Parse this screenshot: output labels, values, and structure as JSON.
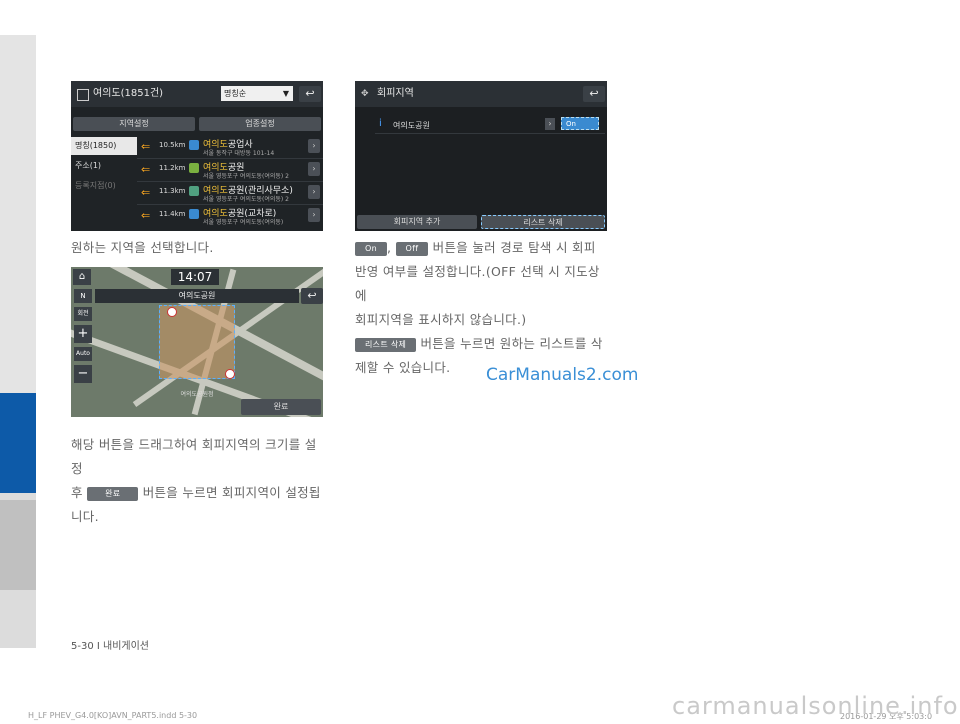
{
  "shot1": {
    "title": "여의도(1851건)",
    "sort_label": "명칭순",
    "tab_region": "지역설정",
    "tab_category": "업종설정",
    "side_tabs": [
      "명칭(1850)",
      "주소(1)",
      "등록지점(0)"
    ],
    "rows": [
      {
        "dist": "10.5km",
        "highlight": "여의도",
        "rest": "공업사",
        "addr": "서울 동작구 대방동 101-14"
      },
      {
        "dist": "11.2km",
        "highlight": "여의도",
        "rest": "공원",
        "addr": "서울 영등포구 여의도동(여의동) 2"
      },
      {
        "dist": "11.3km",
        "highlight": "여의도",
        "rest": "공원(관리사무소)",
        "addr": "서울 영등포구 여의도동(여의동) 2"
      },
      {
        "dist": "11.4km",
        "highlight": "여의도",
        "rest": "공원(교차로)",
        "addr": "서울 영등포구 여의도동(여의동)"
      }
    ]
  },
  "caption1": "원하는 지역을 선택합니다.",
  "shot2": {
    "time": "14:07",
    "place": "여의도공원",
    "done_label": "완료",
    "bottom_label": "여의도공원점",
    "left_controls": [
      "N",
      "회전",
      "+",
      "Auto",
      "−"
    ]
  },
  "caption2": {
    "line1": "해당 버튼을 드래그하여 회피지역의 크기를 설정",
    "line2_pre": "후",
    "pill": "완료",
    "line2_post": "버튼을 누르면 회피지역이 설정됩",
    "line3": "니다."
  },
  "shot3": {
    "title": "회피지역",
    "item": "여의도공원",
    "toggle": "On",
    "btn_add": "회피지역 추가",
    "btn_delete": "리스트 삭제"
  },
  "caption3": {
    "pill_on": "On",
    "comma": ",",
    "pill_off": "Off",
    "line1_post": "버튼을 눌러 경로 탐색 시 회피",
    "line2": "반영 여부를 설정합니다.(OFF 선택 시 지도상에",
    "line3": "회피지역을 표시하지 않습니다.)",
    "pill_delete": "리스트 삭제",
    "line4_post": "버튼을 누르면 원하는 리스트를 삭",
    "line5": "제할 수 있습니다."
  },
  "watermark": "CarManuals2.com",
  "page_number": "5-30 I 내비게이션",
  "footer_file": "H_LF PHEV_G4.0[KO]AVN_PART5.indd   5-30",
  "footer_date": "2016-01-29   오후 5:03:0",
  "big_watermark": "carmanualsonline.info",
  "colors": {
    "sidebar_blue": "#0d5aa8",
    "highlight": "#f2c23a",
    "watermark": "#3a8fd6"
  }
}
